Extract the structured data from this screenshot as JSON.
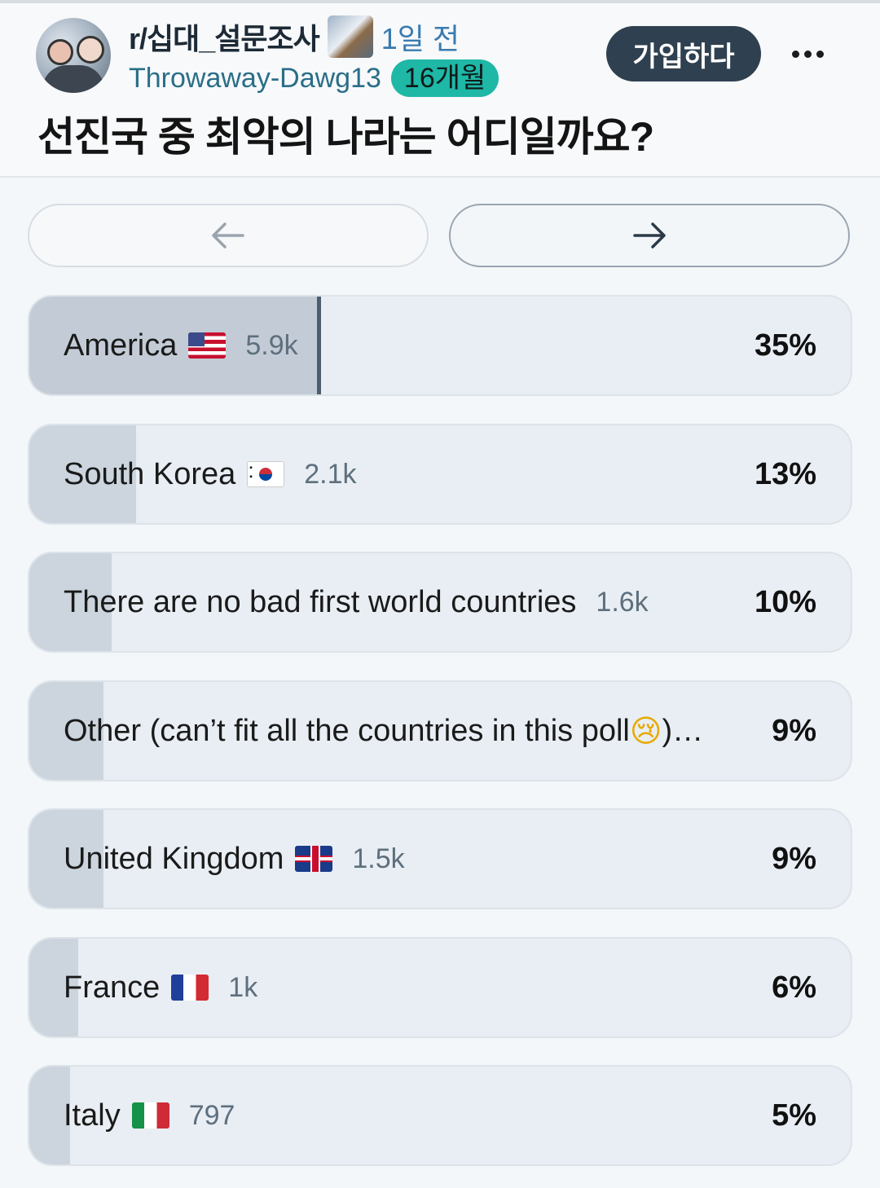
{
  "header": {
    "subreddit": "r/십대_설문조사",
    "time_ago": "1일 전",
    "username": "Throwaway-Dawg13",
    "account_age_badge": "16개월",
    "join_label": "가입하다",
    "more_label": "...",
    "title": "선진국 중 최악의 나라는 어디일까요?"
  },
  "nav": {
    "prev_icon": "arrow-left-icon",
    "next_icon": "arrow-right-icon"
  },
  "poll": {
    "options": [
      {
        "label": "America",
        "flag": "us-flag",
        "count": "5.9k",
        "percent": "35%",
        "share": 0.35
      },
      {
        "label": "South Korea",
        "flag": "kr-flag",
        "count": "2.1k",
        "percent": "13%",
        "share": 0.13
      },
      {
        "label": "There are no bad first world countries",
        "flag": "",
        "count": "1.6k",
        "percent": "10%",
        "share": 0.1
      },
      {
        "label": "Other (can’t fit all the countries in this poll ",
        "emoji": "😢",
        "suffix": ")…",
        "count": "",
        "percent": "9%",
        "share": 0.09
      },
      {
        "label": "United Kingdom",
        "flag": "uk-flag",
        "count": "1.5k",
        "percent": "9%",
        "share": 0.09
      },
      {
        "label": "France",
        "flag": "fr-flag",
        "count": "1k",
        "percent": "6%",
        "share": 0.06
      },
      {
        "label": "Italy",
        "flag": "it-flag",
        "count": "797",
        "percent": "5%",
        "share": 0.05
      }
    ]
  },
  "colors": {
    "join_bg": "#2f4050",
    "badge_bg": "#1fb7a6",
    "bar_fill": "#ccd5de",
    "top_marker": "#4d5d70"
  }
}
